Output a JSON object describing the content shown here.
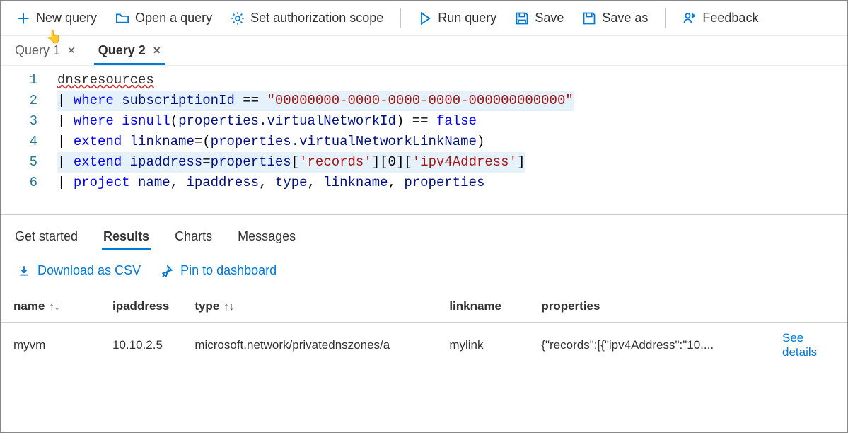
{
  "toolbar": {
    "new_query": "New query",
    "open_query": "Open a query",
    "set_auth": "Set authorization scope",
    "run_query": "Run query",
    "save": "Save",
    "save_as": "Save as",
    "feedback": "Feedback"
  },
  "tabs": [
    {
      "label": "Query 1",
      "active": false
    },
    {
      "label": "Query 2",
      "active": true
    }
  ],
  "editor": {
    "line_numbers": [
      "1",
      "2",
      "3",
      "4",
      "5",
      "6"
    ],
    "line1": {
      "a": "dnsresources"
    },
    "line2": {
      "pipe": "| ",
      "kw": "where ",
      "name": "subscriptionId ",
      "op": "== ",
      "str": "\"00000000-0000-0000-0000-000000000000\""
    },
    "line3": {
      "pipe": "| ",
      "kw": "where ",
      "fn": "isnull",
      "p1": "(",
      "arg": "properties.virtualNetworkId",
      "p2": ") ",
      "op": "== ",
      "val": "false"
    },
    "line4": {
      "pipe": "| ",
      "kw": "extend ",
      "name": "linkname",
      "eq": "=(",
      "arg": "properties.virtualNetworkLinkName",
      "p2": ")"
    },
    "line5": {
      "pipe": "| ",
      "kw": "extend ",
      "name": "ipaddress",
      "eq": "=",
      "arg": "properties",
      "b1": "[",
      "s1": "'records'",
      "b2": "][",
      "i0": "0",
      "b3": "][",
      "s2": "'ipv4Address'",
      "b4": "]"
    },
    "line6": {
      "pipe": "| ",
      "kw": "project ",
      "n1": "name",
      "c1": ", ",
      "n2": "ipaddress",
      "c2": ", ",
      "n3": "type",
      "c3": ", ",
      "n4": "linkname",
      "c4": ", ",
      "n5": "properties"
    }
  },
  "results_tabs": {
    "get_started": "Get started",
    "results": "Results",
    "charts": "Charts",
    "messages": "Messages"
  },
  "result_actions": {
    "download": "Download as CSV",
    "pin": "Pin to dashboard"
  },
  "table": {
    "headers": {
      "name": "name",
      "ipaddress": "ipaddress",
      "type": "type",
      "linkname": "linkname",
      "properties": "properties"
    },
    "rows": [
      {
        "name": "myvm",
        "ipaddress": "10.10.2.5",
        "type": "microsoft.network/privatednszones/a",
        "linkname": "mylink",
        "properties": "{\"records\":[{\"ipv4Address\":\"10....",
        "details": "See details"
      }
    ]
  }
}
